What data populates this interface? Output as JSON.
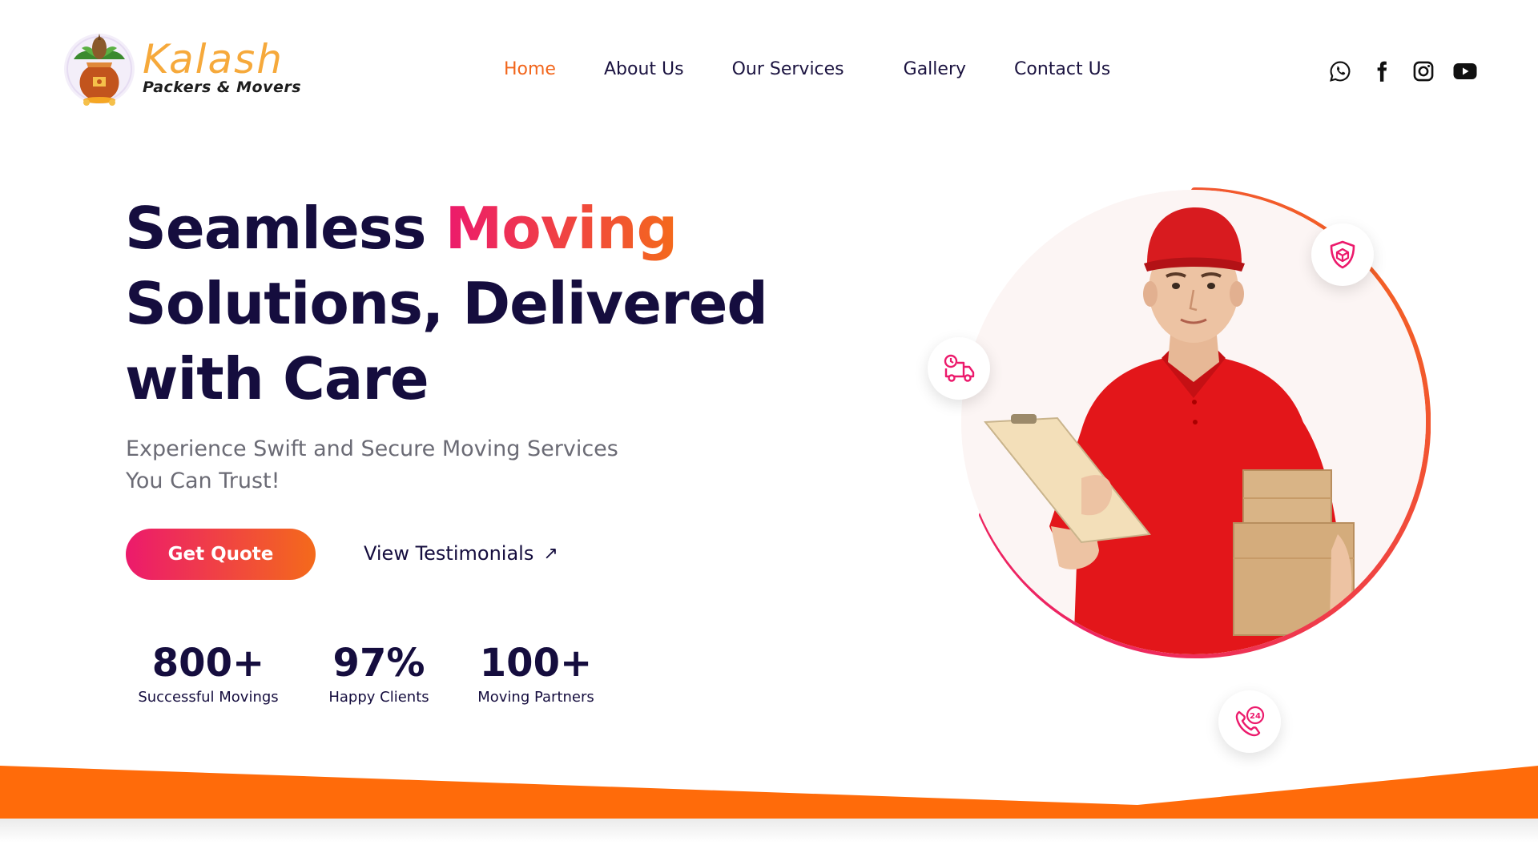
{
  "brand": {
    "name": "Kalash",
    "tagline": "Packers & Movers"
  },
  "nav": {
    "items": [
      {
        "label": "Home",
        "active": true
      },
      {
        "label": "About Us",
        "active": false
      },
      {
        "label": "Our Services",
        "active": false
      },
      {
        "label": "Gallery",
        "active": false
      },
      {
        "label": "Contact Us",
        "active": false
      }
    ]
  },
  "social": [
    "whatsapp-icon",
    "facebook-icon",
    "instagram-icon",
    "youtube-icon"
  ],
  "hero": {
    "title_part1": "Seamless ",
    "title_highlight": "Moving",
    "title_line2": "Solutions, Delivered",
    "title_line3": "with Care",
    "subtitle_line1": "Experience Swift and Secure Moving Services",
    "subtitle_line2": "You Can Trust!",
    "cta_label": "Get Quote",
    "secondary_label": "View Testimonials",
    "secondary_arrow": "↗"
  },
  "stats": [
    {
      "value": "800+",
      "label": "Successful Movings"
    },
    {
      "value": "97%",
      "label": "Happy Clients"
    },
    {
      "value": "100+",
      "label": "Moving Partners"
    }
  ],
  "floating_icons": [
    "shield-box-icon",
    "delivery-truck-icon",
    "support-24-icon"
  ],
  "colors": {
    "accent_orange": "#f46a1b",
    "accent_pink": "#ec1a6c",
    "heading": "#150d3e",
    "wave": "#ff6b0a"
  }
}
